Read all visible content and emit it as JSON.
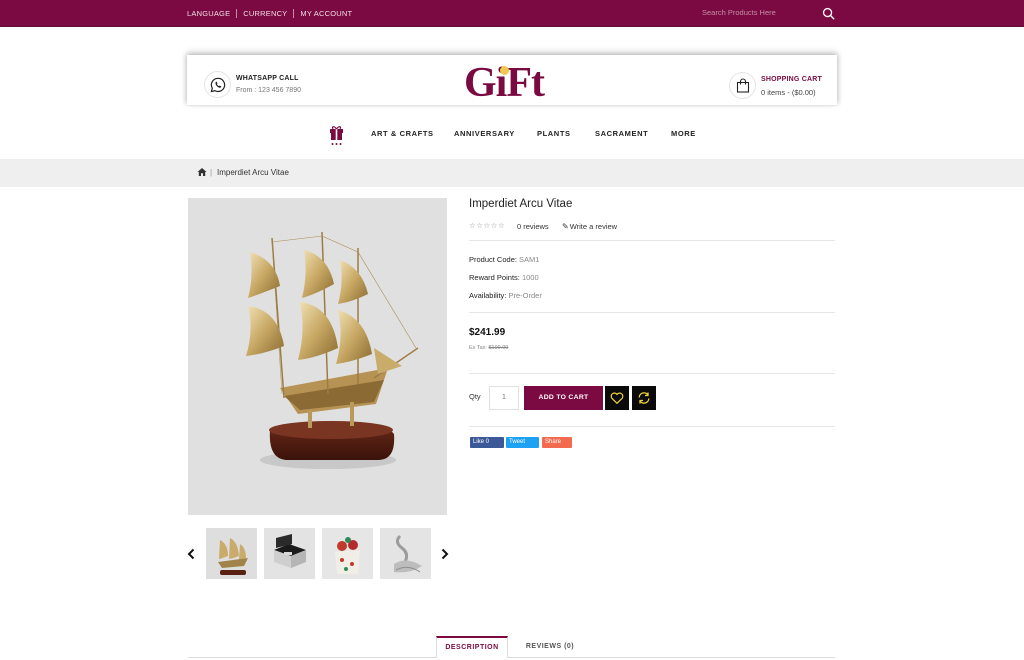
{
  "topbar": {
    "links": [
      "LANGUAGE",
      "CURRENCY",
      "MY ACCOUNT"
    ],
    "search_placeholder": "Search Products Here"
  },
  "header": {
    "whatsapp_title": "WHATSAPP CALL",
    "whatsapp_sub": "From : 123 456 7890",
    "logo_text": "GiFt",
    "cart_title": "SHOPPING CART",
    "cart_sub": "0 items - ($0.00)"
  },
  "nav": {
    "items": [
      "ART & CRAFTS",
      "ANNIVERSARY",
      "PLANTS",
      "SACRAMENT",
      "MORE"
    ]
  },
  "breadcrumb": {
    "current": "Imperdiet Arcu Vitae"
  },
  "product": {
    "title": "Imperdiet Arcu Vitae",
    "stars_display": "☆☆☆☆☆",
    "reviews": "0 reviews",
    "write_review": "Write a review",
    "code_label": "Product Code:",
    "code_value": "SAM1",
    "reward_label": "Reward Points:",
    "reward_value": "1000",
    "avail_label": "Availability:",
    "avail_value": "Pre-Order",
    "price": "$241.99",
    "ex_tax_label": "Ex Tax:",
    "ex_tax_value": "$199.99",
    "qty_label": "Qty",
    "qty_value": "1",
    "add_to_cart": "ADD TO CART"
  },
  "social": {
    "like": "Like 0",
    "tweet": "Tweet",
    "share": "Share"
  },
  "tabs": {
    "description": "DESCRIPTION",
    "reviews": "REVIEWS (0)"
  },
  "colors": {
    "brand": "#7a0a41",
    "wishlist_icon": "#f2d43a",
    "compare_icon": "#f2d43a",
    "facebook": "#3b5998",
    "twitter": "#1da1f2",
    "share": "#f26b4f"
  },
  "icons": [
    "search-icon",
    "whatsapp-icon",
    "shopping-bag-icon",
    "gift-icon",
    "home-icon",
    "pencil-icon",
    "chevron-left-icon",
    "chevron-right-icon",
    "heart-icon",
    "refresh-icon"
  ]
}
